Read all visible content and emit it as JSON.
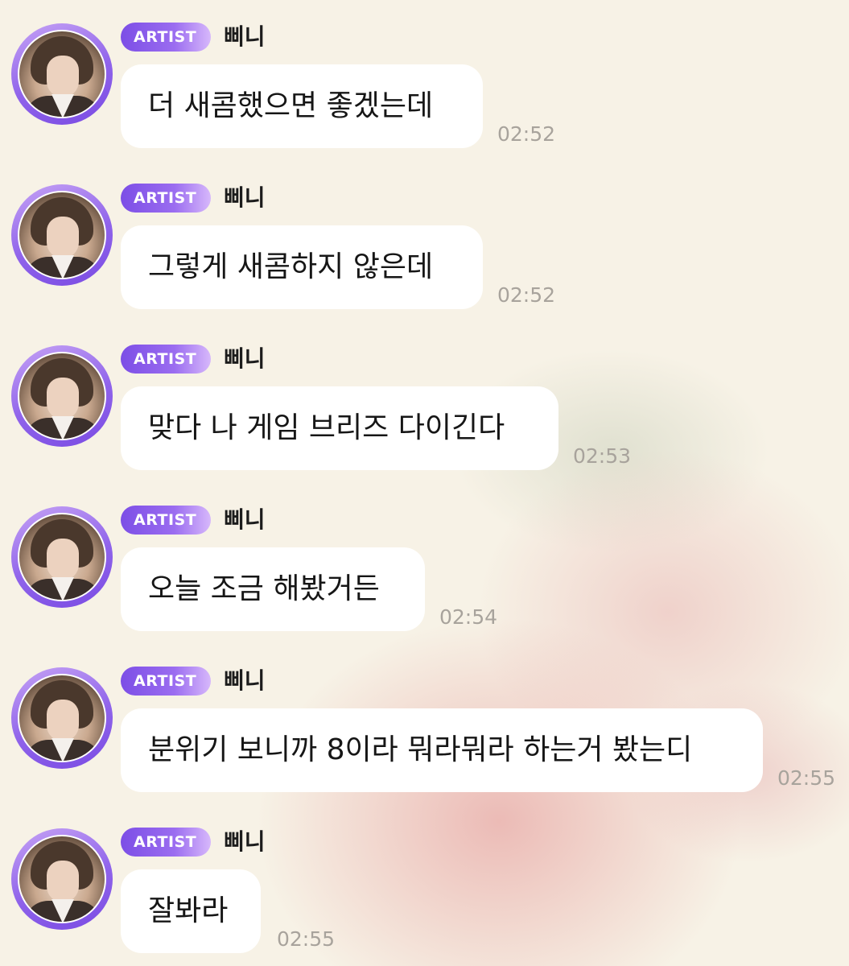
{
  "messages": [
    {
      "badge": "ARTIST",
      "sender": "삐니",
      "text": "더 새콤했으면 좋겠는데",
      "time": "02:52"
    },
    {
      "badge": "ARTIST",
      "sender": "삐니",
      "text": "그렇게 새콤하지 않은데",
      "time": "02:52"
    },
    {
      "badge": "ARTIST",
      "sender": "삐니",
      "text": "맞다 나 게임 브리즈 다이긴다",
      "time": "02:53"
    },
    {
      "badge": "ARTIST",
      "sender": "삐니",
      "text": "오늘 조금 해봤거든",
      "time": "02:54"
    },
    {
      "badge": "ARTIST",
      "sender": "삐니",
      "text": "분위기 보니까 8이라 뭐라뭐라 하는거 봤는디",
      "time": "02:55"
    },
    {
      "badge": "ARTIST",
      "sender": "삐니",
      "text": "잘봐라",
      "time": "02:55"
    }
  ],
  "colors": {
    "background": "#f7f2e6",
    "badge_start": "#7c4ee6",
    "badge_end": "#d7b8fb",
    "bubble": "#ffffff",
    "time_text": "#a8a39c"
  }
}
